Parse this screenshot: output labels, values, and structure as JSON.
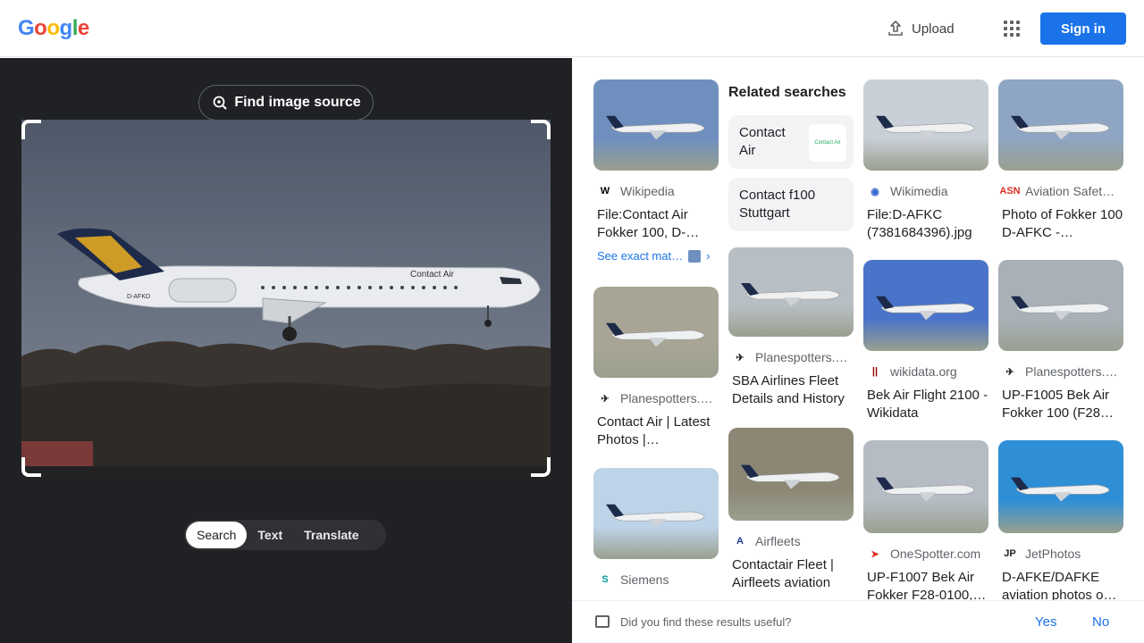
{
  "header": {
    "logo": [
      "G",
      "o",
      "o",
      "g",
      "l",
      "e"
    ],
    "logo_colors": [
      "#4285F4",
      "#EA4335",
      "#FBBC05",
      "#4285F4",
      "#34A853",
      "#EA4335"
    ],
    "upload_label": "Upload",
    "signin_label": "Sign in"
  },
  "left": {
    "find_source_label": "Find image source",
    "photo": {
      "airline_text": "Contact Air",
      "registration": "D-AFKD"
    },
    "tabs": [
      {
        "label": "Search",
        "active": true
      },
      {
        "label": "Text",
        "active": false
      },
      {
        "label": "Translate",
        "active": false
      }
    ]
  },
  "results": {
    "related_title": "Related searches",
    "related": [
      {
        "label": "Contact Air",
        "thumb_text": "Contact Air"
      },
      {
        "label": "Contact f100 Stuttgart"
      }
    ],
    "cards": [
      {
        "source": "Wikipedia",
        "icon": "wikipedia-icon",
        "fav": "W",
        "fav_color": "#000000",
        "title": "File:Contact Air Fokker 100, D-…",
        "see_exact": "See exact mat…",
        "sky": "#6f8fbf"
      },
      {
        "source": "Wikimedia",
        "icon": "wikimedia-icon",
        "fav": "◉",
        "fav_color": "#3366cc",
        "title": "File:D-AFKC (7381684396).jpg …",
        "sky": "#c9cfd6"
      },
      {
        "source": "Aviation Safet…",
        "icon": "asn-icon",
        "fav": "ASN",
        "fav_color": "#d93025",
        "title": "Photo of Fokker 100 D-AFKC -…",
        "sky": "#8ea5c4"
      },
      {
        "source": "Planespotters.…",
        "icon": "planespotters-icon",
        "fav": "✈",
        "fav_color": "#202124",
        "title": "Contact Air | Latest Photos |…",
        "sky": "#a8a596"
      },
      {
        "source": "Planespotters.…",
        "icon": "planespotters-icon",
        "fav": "✈",
        "fav_color": "#202124",
        "title": "SBA Airlines Fleet Details and History",
        "sky": "#b8bfc4"
      },
      {
        "source": "wikidata.org",
        "icon": "wikidata-icon",
        "fav": "||",
        "fav_color": "#990000",
        "title": "Bek Air Flight 2100 - Wikidata",
        "sky": "#4a74c9"
      },
      {
        "source": "Planespotters.…",
        "icon": "planespotters-icon",
        "fav": "✈",
        "fav_color": "#202124",
        "title": "UP-F1005 Bek Air Fokker 100 (F28…",
        "sky": "#a9b0b8"
      },
      {
        "source": "Siemens",
        "icon": "siemens-icon",
        "fav": "S",
        "fav_color": "#009999",
        "title": "",
        "sky": "#bcd3e8"
      },
      {
        "source": "Airfleets",
        "icon": "airfleets-icon",
        "fav": "A",
        "fav_color": "#1a3a8a",
        "title": "Contactair Fleet | Airfleets aviation",
        "sky": "#8c8674"
      },
      {
        "source": "OneSpotter.com",
        "icon": "onespotter-icon",
        "fav": "➤",
        "fav_color": "#d93025",
        "title": "UP-F1007 Bek Air Fokker F28-0100,…",
        "sky": "#b5bcc4"
      },
      {
        "source": "JetPhotos",
        "icon": "jetphotos-icon",
        "fav": "JP",
        "fav_color": "#202124",
        "title": "D-AFKE/DAFKE aviation photos o…",
        "sky": "#2f8fd6"
      }
    ]
  },
  "feedback": {
    "question": "Did you find these results useful?",
    "yes": "Yes",
    "no": "No"
  }
}
